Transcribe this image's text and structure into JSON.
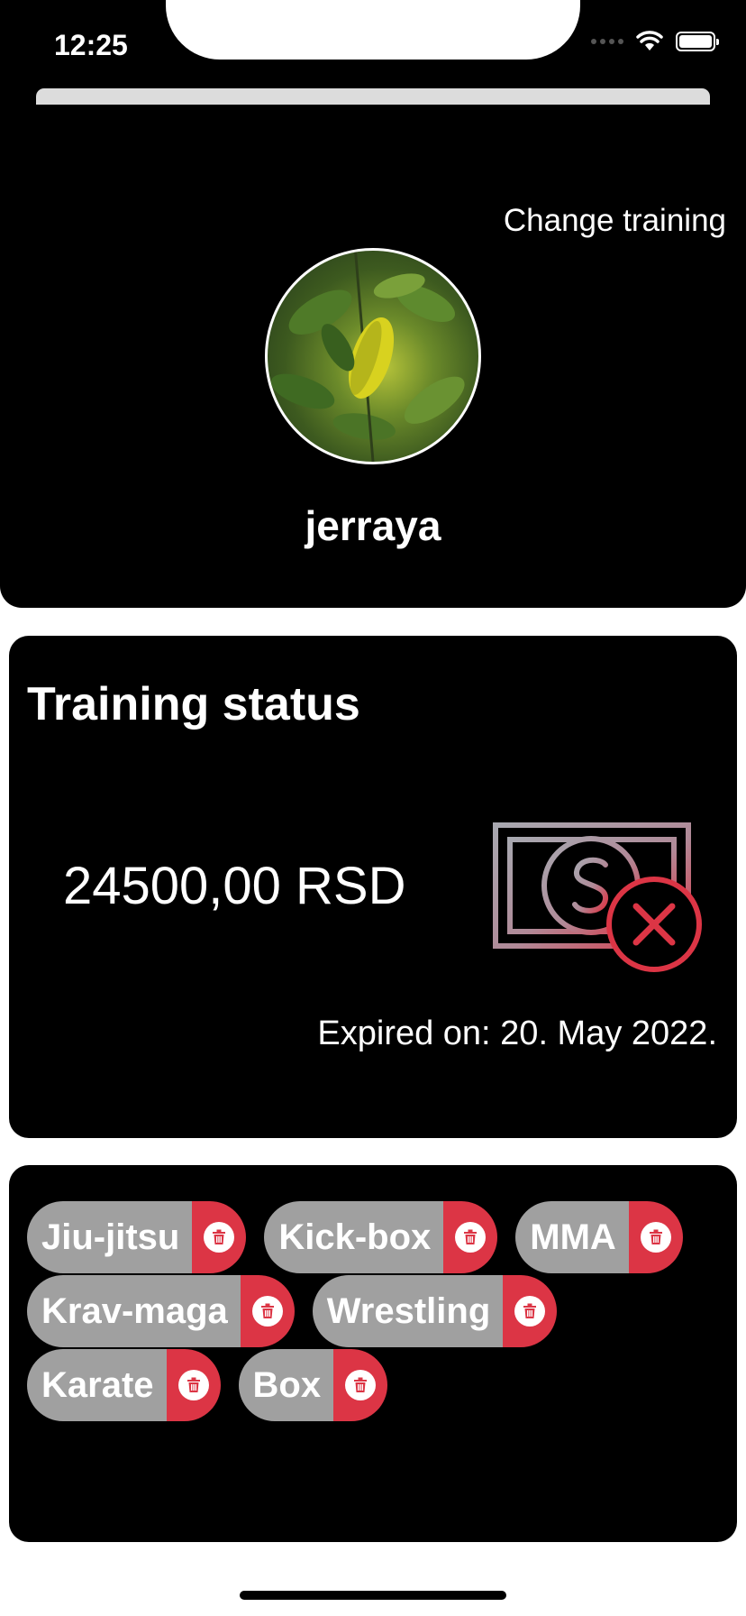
{
  "status_bar": {
    "time": "12:25",
    "icons": [
      "signal-icon",
      "wifi-icon",
      "battery-icon"
    ]
  },
  "header": {
    "change_training_label": "Change training",
    "avatar_icon": "profile-photo",
    "username": "jerraya"
  },
  "training_status": {
    "title": "Training status",
    "amount": "24500,00 RSD",
    "status_icon": "money-cancelled-icon",
    "expired_text": "Expired on: 20. May 2022."
  },
  "trainings": {
    "remove_icon": "trash-icon",
    "items": [
      {
        "label": "Jiu-jitsu"
      },
      {
        "label": "Kick-box"
      },
      {
        "label": "MMA"
      },
      {
        "label": "Krav-maga"
      },
      {
        "label": "Wrestling"
      },
      {
        "label": "Karate"
      },
      {
        "label": "Box"
      }
    ]
  },
  "colors": {
    "card_background": "#000000",
    "tag_background": "#a0a0a0",
    "remove_background": "#dc3545",
    "page_background": "#ffffff"
  }
}
